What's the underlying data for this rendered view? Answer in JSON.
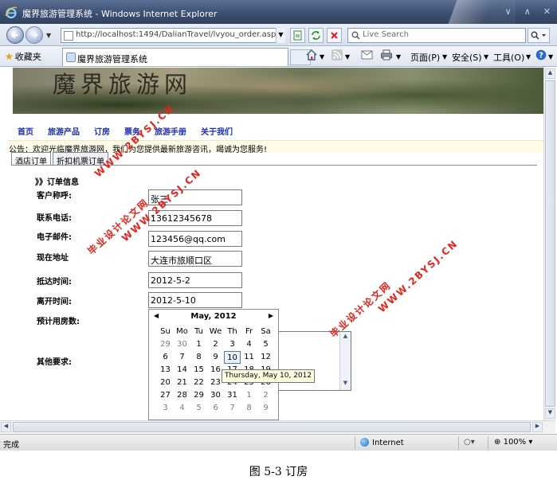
{
  "window": {
    "title": "魔界旅游管理系统 - Windows Internet Explorer"
  },
  "address_bar": {
    "url": "http://localhost:1494/DalianTravel/lvyou_order.aspx?cid=",
    "search_placeholder": "Live Search"
  },
  "command_bar": {
    "favorites_label": "收藏夹",
    "tab_title": "魔界旅游管理系统",
    "page_menu": "页面(P)",
    "safety_menu": "安全(S)",
    "tools_menu": "工具(O)"
  },
  "site": {
    "banner_title": "魔界旅游网",
    "menu": [
      "首页",
      "旅游产品",
      "订房",
      "票务",
      "旅游手册",
      "关于我们"
    ],
    "notice": "公告：欢迎光临魔界旅游网，我们为您提供最新旅游咨讯，竭诚为您服务!",
    "tabs": [
      "酒店订单",
      "折扣机票订单"
    ]
  },
  "order_form": {
    "title": "》》订单信息",
    "labels": {
      "name": "客户称呼:",
      "phone": "联系电话:",
      "email": "电子邮件:",
      "address": "现在地址",
      "arrive": "抵达时间:",
      "leave": "离开时间:",
      "rooms": "预计用房数:",
      "other": "其他要求:"
    },
    "values": {
      "name": "张三",
      "phone": "13612345678",
      "email": "123456@qq.com",
      "address": "大连市旅顺口区",
      "arrive": "2012-5-2",
      "leave": "2012-5-10"
    }
  },
  "calendar": {
    "month_label": "May, 2012",
    "weekdays": [
      "Su",
      "Mo",
      "Tu",
      "We",
      "Th",
      "Fr",
      "Sa"
    ],
    "weeks": [
      [
        "29",
        "30",
        "1",
        "2",
        "3",
        "4",
        "5"
      ],
      [
        "6",
        "7",
        "8",
        "9",
        "10",
        "11",
        "12"
      ],
      [
        "13",
        "14",
        "15",
        "16",
        "17",
        "18",
        "19"
      ],
      [
        "20",
        "21",
        "22",
        "23",
        "24",
        "25",
        "26"
      ],
      [
        "27",
        "28",
        "29",
        "30",
        "31",
        "1",
        "2"
      ],
      [
        "3",
        "4",
        "5",
        "6",
        "7",
        "8",
        "9"
      ]
    ],
    "selected_day": "10",
    "tooltip": "Thursday, May 10, 2012"
  },
  "watermarks": {
    "cn": "毕业设计论文网",
    "url": "WWW.2BYSJ.CN"
  },
  "status_bar": {
    "status": "完成",
    "zone": "Internet",
    "zoom": "100%"
  },
  "caption": "图 5-3  订房",
  "colors": {
    "menu_link": "#1a2db5",
    "watermark": "#e8231b",
    "notice_bg": "#fffbe9"
  }
}
